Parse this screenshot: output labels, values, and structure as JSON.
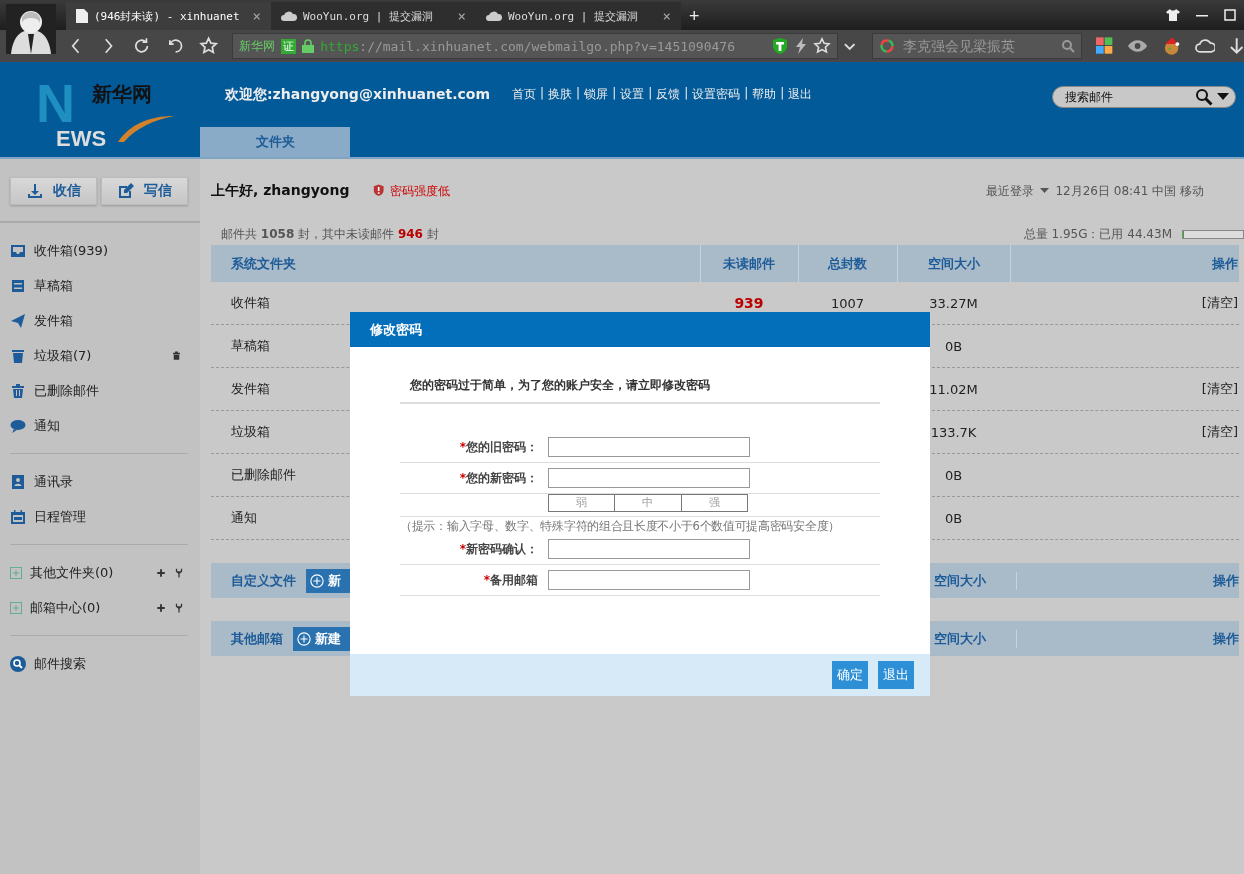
{
  "browser": {
    "tabs": [
      {
        "title": "(946封未读) - xinhuanet",
        "selected": true
      },
      {
        "title": "WooYun.org | 提交漏洞",
        "selected": false
      },
      {
        "title": "WooYun.org | 提交漏洞",
        "selected": false
      }
    ],
    "close_glyph": "×",
    "new_tab": "+",
    "site_name": "新华网",
    "cert_badge": "证",
    "url_scheme": "https",
    "url_rest": "://mail.xinhuanet.com/webmailgo.php?v=1451090476",
    "search": {
      "placeholder": "李克强会见梁振英"
    }
  },
  "header": {
    "logo": {
      "letter": "N",
      "word": "EWS",
      "name": "新华网"
    },
    "welcome": "欢迎您:zhangyong@xinhuanet.com",
    "nav": [
      "首页",
      "换肤",
      "锁屏",
      "设置",
      "反馈",
      "设置密码",
      "帮助",
      "退出"
    ],
    "nav_separator": "|",
    "search": {
      "placeholder": "搜索邮件"
    },
    "tabs": [
      {
        "label": "文件夹",
        "selected": true
      }
    ]
  },
  "sidebar": {
    "buttons": [
      "收信",
      "写信"
    ],
    "groups": [
      [
        {
          "label": "收件箱(939)"
        },
        {
          "label": "草稿箱"
        },
        {
          "label": "发件箱"
        },
        {
          "label": "垃圾箱(7)",
          "clear": true
        },
        {
          "label": "已删除邮件"
        },
        {
          "label": "通知"
        }
      ],
      [
        {
          "label": "通讯录"
        },
        {
          "label": "日程管理"
        }
      ],
      [
        {
          "label": "其他文件夹(0)",
          "expanded": false
        },
        {
          "label": "邮箱中心(0)",
          "expanded": false
        }
      ],
      [
        {
          "label": "邮件搜索"
        }
      ]
    ]
  },
  "main": {
    "greeting": "上午好, zhangyong",
    "warning": "密码强度低",
    "last_login_label": "最近登录",
    "last_login": "12月26日 08:41 中国 移动",
    "stats": "邮件共 **1058** 封，其中未读邮件 **946** 封",
    "quota": "总量 1.95G：已用 44.43M",
    "quota_bar": {
      "level": 0.02
    },
    "columns": [
      "系统文件夹",
      "未读邮件",
      "总封数",
      "空间大小",
      "操作"
    ],
    "rows": [
      {
        "name": "收件箱",
        "unread": "939",
        "total": "1007",
        "size": "33.27M",
        "action": "[清空]"
      },
      {
        "name": "草稿箱",
        "size": "0B"
      },
      {
        "name": "发件箱",
        "size": "11.02M",
        "action": "[清空]"
      },
      {
        "name": "垃圾箱",
        "size": "133.7K",
        "action": "[清空]"
      },
      {
        "name": "已删除邮件",
        "size": "0B"
      },
      {
        "name": "通知",
        "size": "0B"
      }
    ],
    "sections": [
      {
        "title": "自定义文件",
        "button": "新",
        "size": "空间大小",
        "action": "操作"
      },
      {
        "title": "其他邮箱",
        "button": "新建",
        "size": "空间大小",
        "action": "操作"
      }
    ]
  },
  "dialog": {
    "title": "修改密码",
    "message": "您的密码过于简单，为了您的账户安全，请立即修改密码",
    "required_mark": "*",
    "fields": [
      {
        "kind": "field",
        "label": "您的旧密码：",
        "required": true
      },
      {
        "kind": "field",
        "label": "您的新密码：",
        "required": true
      },
      {
        "kind": "strength",
        "levels": [
          {
            "label": "弱",
            "selected": false
          },
          {
            "label": "中",
            "selected": false
          },
          {
            "label": "强",
            "selected": false
          }
        ]
      },
      {
        "kind": "hint",
        "text": "（提示：输入字母、数字、特殊字符的组合且长度不小于6个数值可提高密码安全度）"
      },
      {
        "kind": "field",
        "label": "新密码确认：",
        "required": true
      },
      {
        "kind": "field",
        "label": "备用邮箱",
        "required": true
      }
    ],
    "buttons": [
      "确定",
      "退出"
    ]
  }
}
